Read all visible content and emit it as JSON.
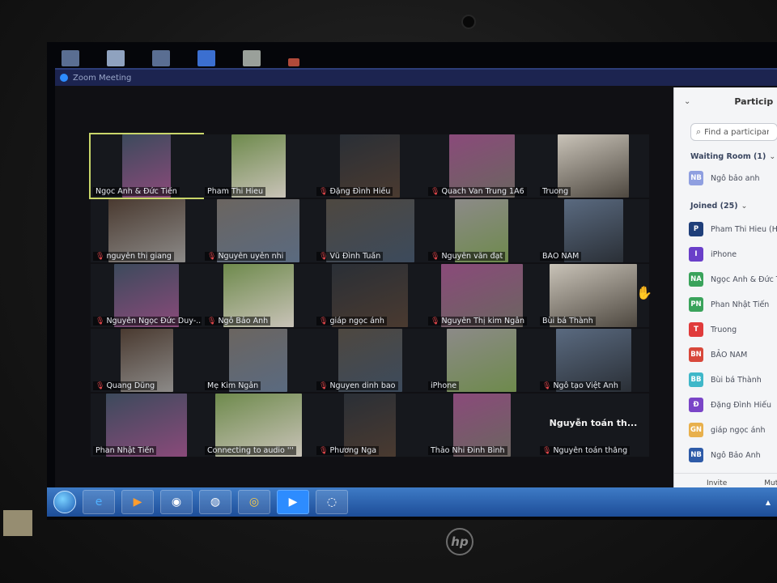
{
  "window": {
    "title": "Zoom Meeting"
  },
  "colors": {
    "accent": "#2d8cff",
    "panel_bg": "#f4f5f7",
    "muted_icon": "#e5474b",
    "active_speaker": "#c9d66a"
  },
  "grid": {
    "tiles": [
      {
        "name": "Ngọc Anh & Đức Tiến",
        "muted": false,
        "active": true
      },
      {
        "name": "Pham Thi Hieu",
        "muted": false
      },
      {
        "name": "Đặng Đình Hiếu",
        "muted": true
      },
      {
        "name": "Quach Van Trung 1A6",
        "muted": true
      },
      {
        "name": "Truong",
        "muted": false
      },
      {
        "name": "nguyễn thị giang",
        "muted": true
      },
      {
        "name": "Nguyễn uyên nhi",
        "muted": true
      },
      {
        "name": "Vũ Đình Tuấn",
        "muted": true
      },
      {
        "name": "Nguyễn văn đạt",
        "muted": true
      },
      {
        "name": "BẢO NAM",
        "muted": false
      },
      {
        "name": "Nguyễn Ngọc Đức Duy-...",
        "muted": true
      },
      {
        "name": "Ngô Bảo Anh",
        "muted": true
      },
      {
        "name": "giáp ngọc ánh",
        "muted": true
      },
      {
        "name": "Nguyễn Thị kim Ngân",
        "muted": true
      },
      {
        "name": "Bùi bá Thành",
        "muted": false
      },
      {
        "name": "Quang Dũng",
        "muted": true
      },
      {
        "name": "Mẹ Kim Ngân",
        "muted": false
      },
      {
        "name": "Nguyen dinh bao",
        "muted": true
      },
      {
        "name": "iPhone",
        "muted": false
      },
      {
        "name": "Ngô tạo Việt Anh",
        "muted": true
      },
      {
        "name": "Phan Nhật Tiến",
        "muted": false
      },
      {
        "name": "Connecting to audio '''",
        "muted": false
      },
      {
        "name": "Phương Nga",
        "muted": true
      },
      {
        "name": "Thảo Nhi Đinh Bình",
        "muted": false
      },
      {
        "name": "Nguyễn toán thắng",
        "muted": true,
        "center_label": "Nguyễn toán th..."
      }
    ]
  },
  "participants_panel": {
    "title": "Particip",
    "search_placeholder": "Find a participant",
    "waiting_label": "Waiting Room (1)",
    "waiting": [
      {
        "initials": "NB",
        "name": "Ngô bảo anh",
        "color": "#8f9fe0"
      }
    ],
    "joined_label": "Joined (25)",
    "joined": [
      {
        "initials": "P",
        "name": "Pham Thi Hieu (Ho",
        "color": "#1f3f7a"
      },
      {
        "initials": "I",
        "name": "iPhone",
        "color": "#6a3fc9"
      },
      {
        "initials": "NA",
        "name": "Ngọc Anh & Đức T",
        "color": "#3aa35b"
      },
      {
        "initials": "PN",
        "name": "Phan Nhật Tiến",
        "color": "#3aa35b"
      },
      {
        "initials": "T",
        "name": "Truong",
        "color": "#e03b3b"
      },
      {
        "initials": "BN",
        "name": "BẢO NAM",
        "color": "#d8483b"
      },
      {
        "initials": "BB",
        "name": "Bùi bá Thành",
        "color": "#3fb7c9"
      },
      {
        "initials": "Đ",
        "name": "Đặng Đình Hiếu",
        "color": "#7a45c7"
      },
      {
        "initials": "GN",
        "name": "giáp ngọc ánh",
        "color": "#e8b04c"
      },
      {
        "initials": "NB",
        "name": "Ngô Bảo Anh",
        "color": "#2e5ba8"
      }
    ],
    "footer": {
      "invite": "Invite",
      "mute": "Mut"
    }
  },
  "device": {
    "brand": "hp"
  }
}
